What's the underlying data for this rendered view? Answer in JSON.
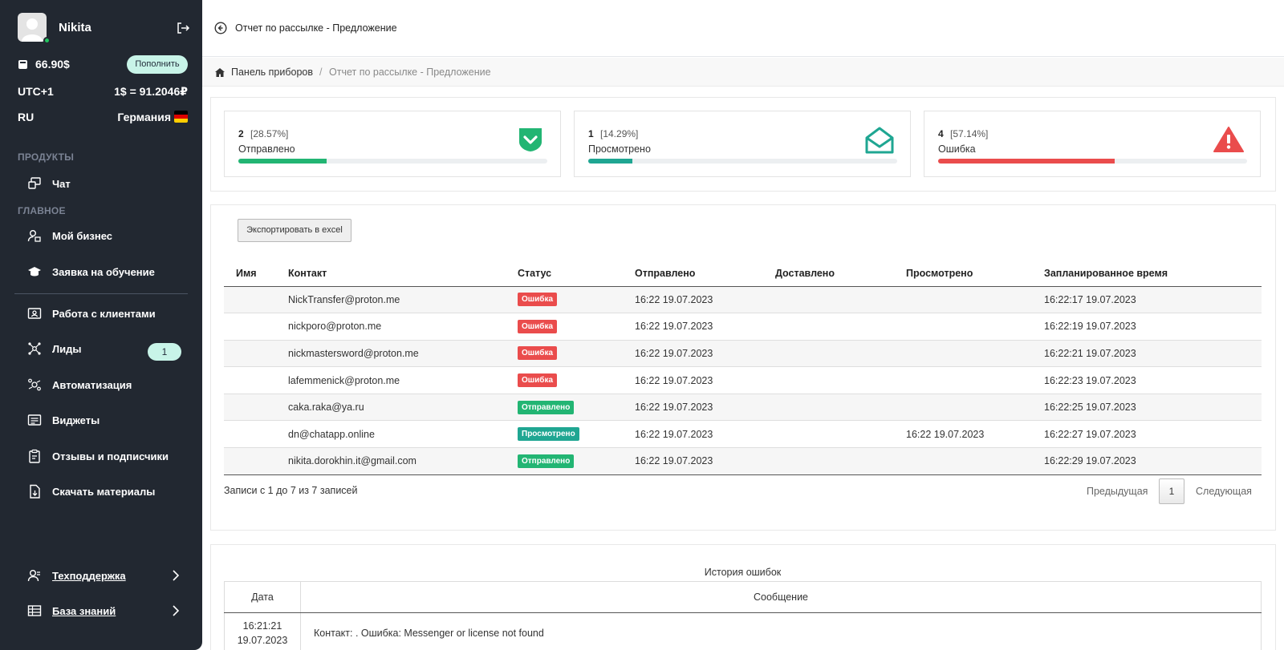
{
  "sidebar": {
    "username": "Nikita",
    "balance": "66.90$",
    "topup_label": "Пополнить",
    "timezone": "UTC+1",
    "rate": "1$ = 91.2046₽",
    "lang": "RU",
    "country": "Германия",
    "section_products": "ПРОДУКТЫ",
    "section_main": "ГЛАВНОЕ",
    "items": {
      "chat": "Чат",
      "my_business": "Мой бизнес",
      "training": "Заявка на обучение",
      "clients": "Работа с клиентами",
      "leads": "Лиды",
      "leads_count": "1",
      "automation": "Автоматизация",
      "widgets": "Виджеты",
      "reviews": "Отзывы и подписчики",
      "downloads": "Скачать материалы",
      "support": "Техподдержка",
      "knowledge": "База знаний"
    }
  },
  "topbar": {
    "title": "Отчет по рассылке - Предложение"
  },
  "breadcrumb": {
    "home": "Панель приборов",
    "sep": "/",
    "current": "Отчет по рассылке - Предложение"
  },
  "stats": [
    {
      "count": "2",
      "percent": "[28.57%]",
      "label": "Отправлено",
      "progress": 28.57,
      "color": "#22b573",
      "icon": "check-shield-icon"
    },
    {
      "count": "1",
      "percent": "[14.29%]",
      "label": "Просмотрено",
      "progress": 14.29,
      "color": "#1fa692",
      "icon": "open-envelope-icon"
    },
    {
      "count": "4",
      "percent": "[57.14%]",
      "label": "Ошибка",
      "progress": 57.14,
      "color": "#ea4c4c",
      "icon": "warning-icon"
    }
  ],
  "export_label": "Экспортировать в excel",
  "table": {
    "headers": {
      "name": "Имя",
      "contact": "Контакт",
      "status": "Статус",
      "sent": "Отправлено",
      "delivered": "Доставлено",
      "viewed": "Просмотрено",
      "scheduled": "Запланированное время"
    },
    "rows": [
      {
        "name": "",
        "contact": "NickTransfer@proton.me",
        "status": "Ошибка",
        "status_color": "#ea4c4c",
        "sent": "16:22 19.07.2023",
        "delivered": "",
        "viewed": "",
        "scheduled": "16:22:17 19.07.2023"
      },
      {
        "name": "",
        "contact": "nickporo@proton.me",
        "status": "Ошибка",
        "status_color": "#ea4c4c",
        "sent": "16:22 19.07.2023",
        "delivered": "",
        "viewed": "",
        "scheduled": "16:22:19 19.07.2023"
      },
      {
        "name": "",
        "contact": "nickmastersword@proton.me",
        "status": "Ошибка",
        "status_color": "#ea4c4c",
        "sent": "16:22 19.07.2023",
        "delivered": "",
        "viewed": "",
        "scheduled": "16:22:21 19.07.2023"
      },
      {
        "name": "",
        "contact": "lafemmenick@proton.me",
        "status": "Ошибка",
        "status_color": "#ea4c4c",
        "sent": "16:22 19.07.2023",
        "delivered": "",
        "viewed": "",
        "scheduled": "16:22:23 19.07.2023"
      },
      {
        "name": "",
        "contact": "caka.raka@ya.ru",
        "status": "Отправлено",
        "status_color": "#22b573",
        "sent": "16:22 19.07.2023",
        "delivered": "",
        "viewed": "",
        "scheduled": "16:22:25 19.07.2023"
      },
      {
        "name": "",
        "contact": "dn@chatapp.online",
        "status": "Просмотрено",
        "status_color": "#1fa692",
        "sent": "16:22 19.07.2023",
        "delivered": "",
        "viewed": "16:22 19.07.2023",
        "scheduled": "16:22:27 19.07.2023"
      },
      {
        "name": "",
        "contact": "nikita.dorokhin.it@gmail.com",
        "status": "Отправлено",
        "status_color": "#22b573",
        "sent": "16:22 19.07.2023",
        "delivered": "",
        "viewed": "",
        "scheduled": "16:22:29 19.07.2023"
      }
    ],
    "info": "Записи с 1 до 7 из 7 записей",
    "prev": "Предыдущая",
    "page": "1",
    "next": "Следующая"
  },
  "errors": {
    "caption": "История ошибок",
    "headers": {
      "date": "Дата",
      "message": "Сообщение"
    },
    "rows": [
      {
        "time": "16:21:21",
        "date": "19.07.2023",
        "message": "Контакт: . Ошибка: Messenger or license not found"
      }
    ]
  }
}
